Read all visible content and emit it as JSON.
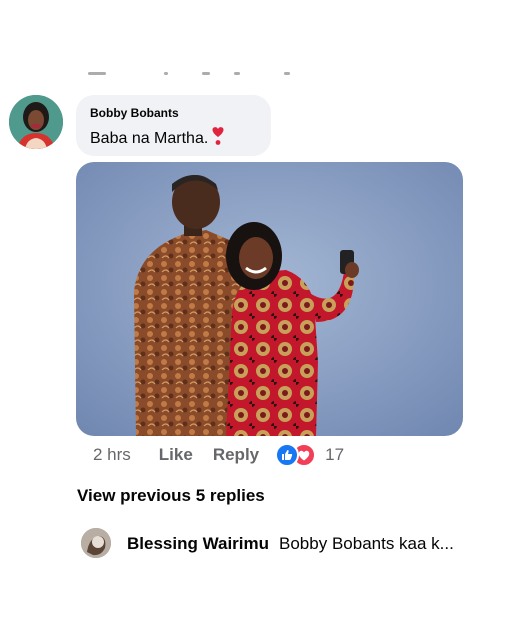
{
  "comment": {
    "author": "Bobby Bobants",
    "text": "Baba na Martha.",
    "emoji_icon": "red-heart-exclamation-icon",
    "time": "2 hrs",
    "like_label": "Like",
    "reply_label": "Reply",
    "reaction_count": "17",
    "reactions": [
      "like-icon",
      "love-icon"
    ]
  },
  "replies": {
    "view_previous_label": "View previous 5 replies",
    "latest": {
      "author": "Blessing Wairimu",
      "preview": "Bobby Bobants kaa k..."
    }
  },
  "colors": {
    "bubble_bg": "#f0f2f5",
    "meta_text": "#65676b",
    "like_blue": "#1877f2",
    "love_red": "#f33e58"
  }
}
